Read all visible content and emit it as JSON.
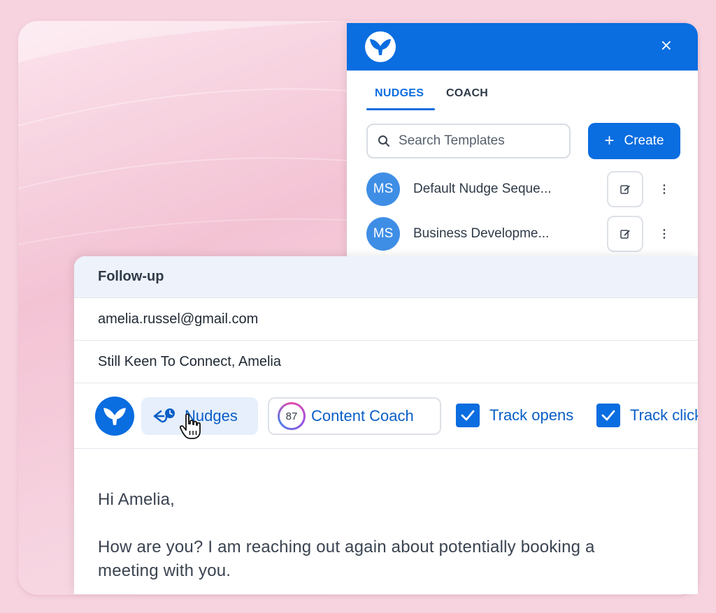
{
  "panel": {
    "close_glyph": "×",
    "tabs": [
      {
        "label": "NUDGES",
        "active": true
      },
      {
        "label": "COACH",
        "active": false
      }
    ],
    "search": {
      "placeholder": "Search Templates",
      "icon": "search-icon"
    },
    "create_button": {
      "label": "Create",
      "icon": "plus-icon"
    },
    "templates": [
      {
        "initials": "MS",
        "name": "Default Nudge Seque..."
      },
      {
        "initials": "MS",
        "name": "Business Developme..."
      }
    ],
    "accent_color": "#0a6de0"
  },
  "compose": {
    "title": "Follow-up",
    "to": "amelia.russel@gmail.com",
    "subject": "Still Keen To Connect, Amelia",
    "toolbar": {
      "nudges_label": "Nudges",
      "coach_score": "87",
      "coach_label": "Content Coach",
      "track_opens_label": "Track opens",
      "track_clicks_label": "Track clicks",
      "track_opens_checked": true,
      "track_clicks_checked": true
    },
    "body": {
      "greeting": "Hi Amelia,",
      "paragraph": "How are you? I am reaching out again about potentially booking a meeting with you."
    }
  }
}
